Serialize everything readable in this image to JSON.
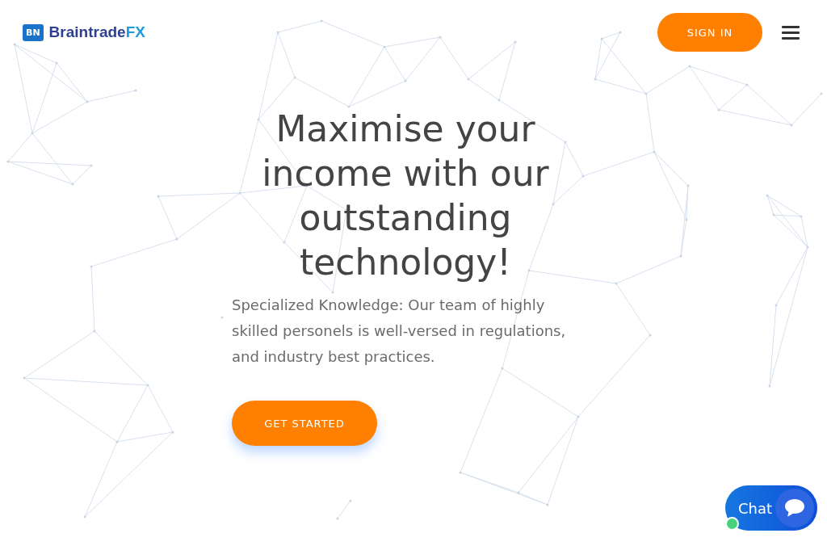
{
  "header": {
    "logo": {
      "badge": "BN",
      "name": "Braintrade",
      "suffix": "FX"
    },
    "sign_in": "SIGN IN"
  },
  "hero": {
    "title": "Maximise your income with our outstanding technology!",
    "text": "Specialized Knowledge: Our team of highly skilled personels is well-versed in regulations, and industry best practices.",
    "button": "GET STARTED"
  },
  "chat": {
    "label": "Chat",
    "online": true
  }
}
